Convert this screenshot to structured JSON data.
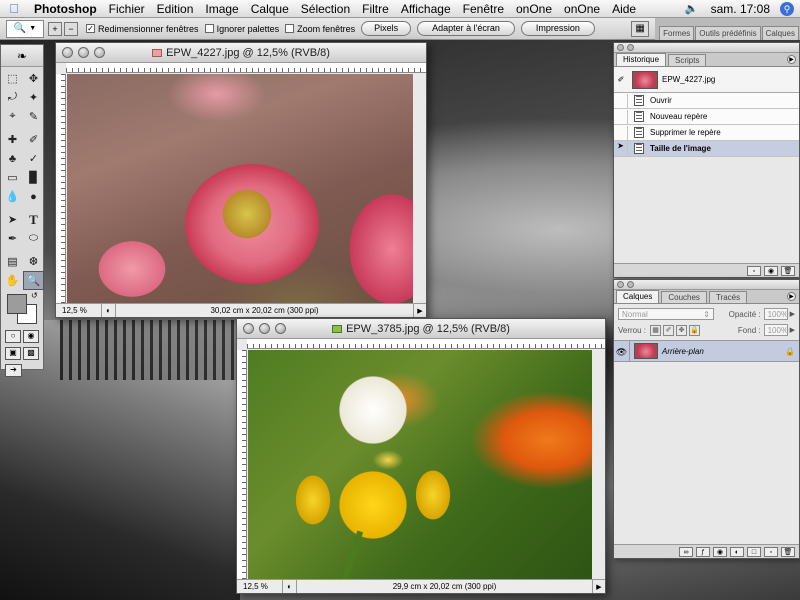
{
  "menubar": {
    "items": [
      "Photoshop",
      "Fichier",
      "Edition",
      "Image",
      "Calque",
      "Sélection",
      "Filtre",
      "Affichage",
      "Fenêtre",
      "onOne",
      "onOne",
      "Aide"
    ],
    "clock": "sam. 17:08"
  },
  "options": {
    "resize_windows": "Redimensionner fenêtres",
    "ignore_palettes": "Ignorer palettes",
    "zoom_windows": "Zoom fenêtres",
    "pixels": "Pixels",
    "fit_screen": "Adapter à l'écran",
    "print": "Impression",
    "well_tabs": [
      "Formes",
      "Outils prédéfinis",
      "Calques"
    ]
  },
  "doc1": {
    "title": "EPW_4227.jpg @ 12,5% (RVB/8)",
    "zoom": "12,5 %",
    "info": "30,02 cm x 20,02 cm (300 ppi)"
  },
  "doc2": {
    "title": "EPW_3785.jpg @ 12,5% (RVB/8)",
    "zoom": "12,5 %",
    "info": "29,9 cm x 20,02 cm (300 ppi)"
  },
  "history": {
    "tabs": [
      "Historique",
      "Scripts"
    ],
    "snapshot": "EPW_4227.jpg",
    "items": [
      "Ouvrir",
      "Nouveau repère",
      "Supprimer le repère",
      "Taille de l'image"
    ]
  },
  "layers": {
    "tabs": [
      "Calques",
      "Couches",
      "Tracés"
    ],
    "blend_mode": "Normal",
    "opacity_label": "Opacité :",
    "opacity_value": "100%",
    "lock_label": "Verrou :",
    "fill_label": "Fond :",
    "fill_value": "100%",
    "layer_name": "Arrière-plan"
  }
}
